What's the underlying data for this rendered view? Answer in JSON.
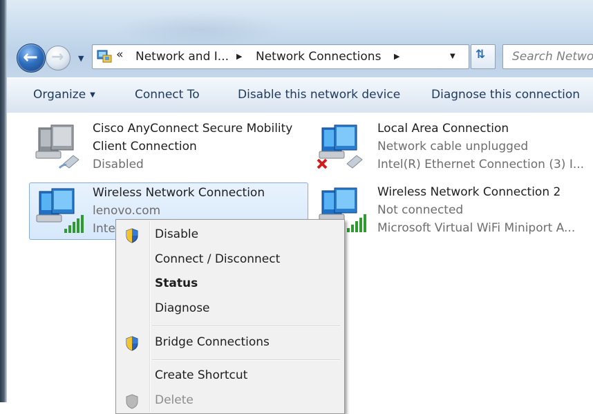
{
  "navigation": {
    "back_icon": "back-arrow-icon",
    "forward_icon": "forward-arrow-icon",
    "history_icon": "chevron-down-icon"
  },
  "address_bar": {
    "overflow": "«",
    "crumbs": [
      "Network and I...",
      "Network Connections"
    ],
    "refresh_icon": "refresh-icon"
  },
  "search": {
    "placeholder": "Search Netwo"
  },
  "command_bar": {
    "organize": "Organize",
    "connect_to": "Connect To",
    "disable_device": "Disable this network device",
    "diagnose": "Diagnose this connection"
  },
  "connections": [
    {
      "name_line1": "Cisco AnyConnect Secure Mobility",
      "name_line2": "Client Connection",
      "status": "Disabled",
      "icon": "network-adapter-disabled-icon"
    },
    {
      "name": "Local Area Connection",
      "status": "Network cable unplugged",
      "device": "Intel(R) Ethernet Connection (3) I...",
      "icon": "network-adapter-unplugged-icon"
    },
    {
      "name": "Wireless Network Connection",
      "status": "lenovo.com",
      "device": "Inte",
      "icon": "wireless-adapter-icon",
      "selected": true
    },
    {
      "name": "Wireless Network Connection 2",
      "status": "Not connected",
      "device": "Microsoft Virtual WiFi Miniport A...",
      "icon": "wireless-adapter-icon"
    }
  ],
  "context_menu": {
    "items": [
      {
        "label": "Disable",
        "icon": "uac-shield-icon"
      },
      {
        "label": "Connect / Disconnect"
      },
      {
        "label": "Status",
        "bold": true
      },
      {
        "label": "Diagnose"
      },
      {
        "label": "Bridge Connections",
        "icon": "uac-shield-icon"
      },
      {
        "label": "Create Shortcut"
      },
      {
        "label": "Delete",
        "disabled": true,
        "icon": "uac-shield-icon"
      }
    ]
  },
  "colors": {
    "accent": "#2f6fbf",
    "selection": "#d6e8fb",
    "command_text": "#1e395b"
  }
}
